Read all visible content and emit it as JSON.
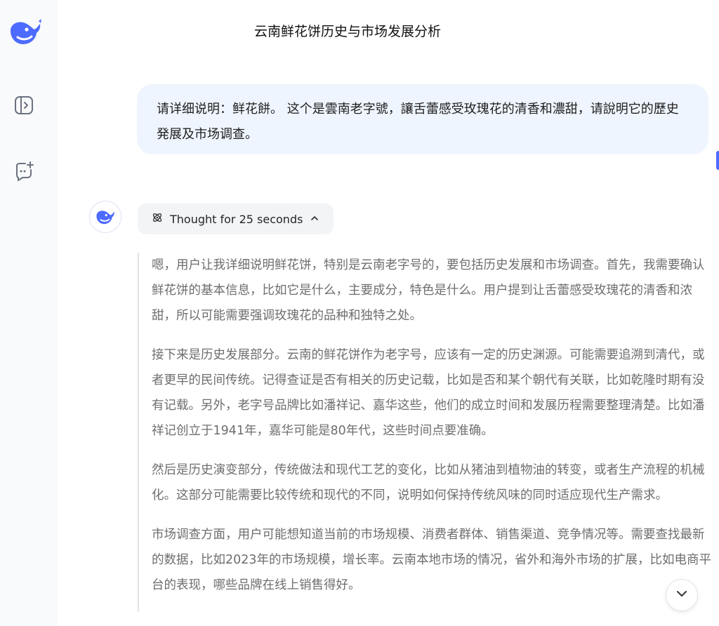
{
  "app": {
    "title": "云南鲜花饼历史与市场发展分析",
    "accent_color": "#4d6bfe"
  },
  "sidebar": {
    "icons": [
      "deepseek-logo-icon",
      "sidebar-toggle-icon",
      "new-chat-icon"
    ]
  },
  "conversation": {
    "user_message": "请详细说明：鲜花餅。 这个是雲南老字號，讓舌蕾感受玫瑰花的清香和濃甜，请說明它的歷史発展及市场调查。",
    "thought_label": "Thought for 25 seconds",
    "thinking_paragraphs": [
      "嗯，用户让我详细说明鲜花饼，特别是云南老字号的，要包括历史发展和市场调查。首先，我需要确认鲜花饼的基本信息，比如它是什么，主要成分，特色是什么。用户提到让舌蕾感受玫瑰花的清香和浓甜，所以可能需要强调玫瑰花的品种和独特之处。",
      "接下来是历史发展部分。云南的鲜花饼作为老字号，应该有一定的历史渊源。可能需要追溯到清代，或者更早的民间传统。记得查证是否有相关的历史记载，比如是否和某个朝代有关联，比如乾隆时期有没有记载。另外，老字号品牌比如潘祥记、嘉华这些，他们的成立时间和发展历程需要整理清楚。比如潘祥记创立于1941年，嘉华可能是80年代，这些时间点要准确。",
      "然后是历史演变部分，传统做法和现代工艺的变化，比如从猪油到植物油的转变，或者生产流程的机械化。这部分可能需要比较传统和现代的不同，说明如何保持传统风味的同时适应现代生产需求。",
      "市场调查方面，用户可能想知道当前的市场规模、消费者群体、销售渠道、竞争情况等。需要查找最新的数据，比如2023年的市场规模，增长率。云南本地市场的情况，省外和海外市场的扩展，比如电商平台的表现，哪些品牌在线上销售得好。"
    ]
  }
}
